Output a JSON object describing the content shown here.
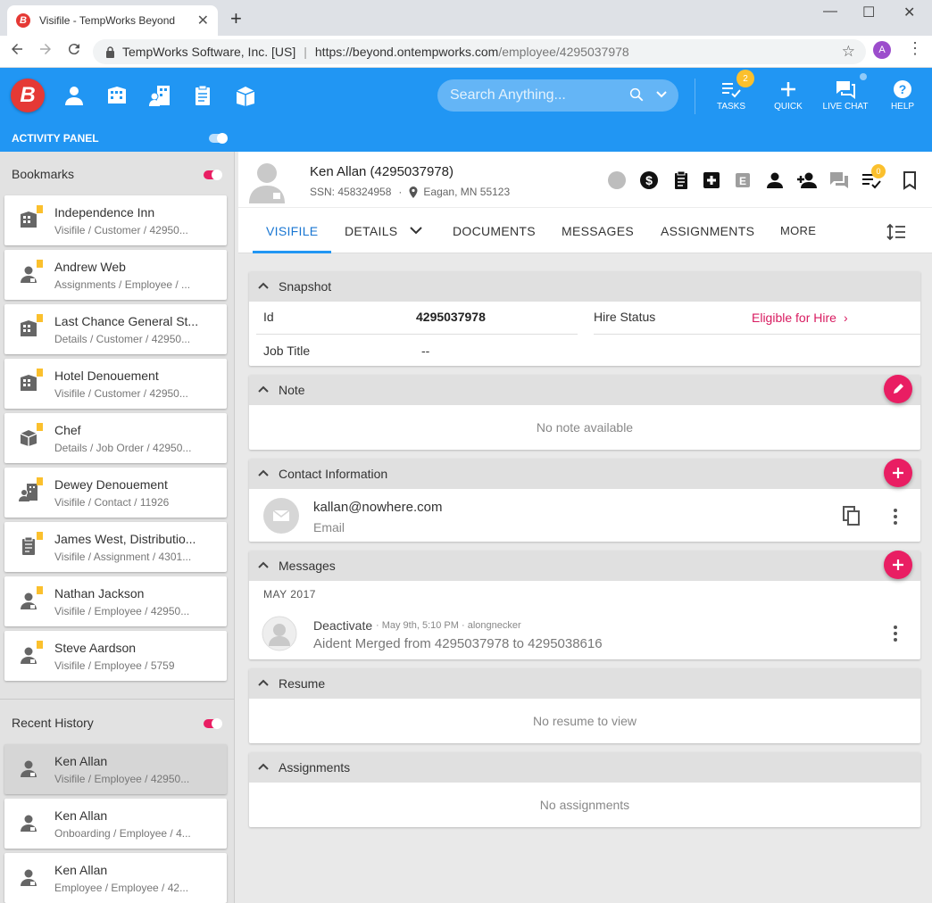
{
  "browser": {
    "tab_title": "Visifile - TempWorks Beyond",
    "tab_favicon": "B",
    "close_tab": "✕",
    "new_tab": "+",
    "window_min": "—",
    "window_max": "☐",
    "window_close": "✕",
    "org_label": "TempWorks Software, Inc. [US]",
    "url_host": "https://beyond.ontempworks.com",
    "url_path": "/employee/4295037978",
    "profile_initial": "A"
  },
  "header": {
    "logo": "B",
    "search_placeholder": "Search Anything...",
    "tasks_label": "TASKS",
    "tasks_badge": "2",
    "quick_label": "QUICK",
    "live_chat_label": "LIVE CHAT",
    "help_label": "HELP"
  },
  "activity_panel": {
    "label": "ACTIVITY PANEL"
  },
  "sidebar": {
    "bookmarks_title": "Bookmarks",
    "recent_title": "Recent History",
    "bookmarks": [
      {
        "title": "Independence Inn",
        "sub": "Visifile / Customer / 42950...",
        "icon": "building-icon"
      },
      {
        "title": "Andrew Web",
        "sub": "Assignments / Employee / ...",
        "icon": "person-icon"
      },
      {
        "title": "Last Chance General St...",
        "sub": "Details / Customer / 42950...",
        "icon": "building-icon"
      },
      {
        "title": "Hotel Denouement",
        "sub": "Visifile / Customer / 42950...",
        "icon": "building-icon"
      },
      {
        "title": "Chef",
        "sub": "Details / Job Order / 42950...",
        "icon": "job-order-icon"
      },
      {
        "title": "Dewey Denouement",
        "sub": "Visifile / Contact / 11926",
        "icon": "contact-icon"
      },
      {
        "title": "James West, Distributio...",
        "sub": "Visifile / Assignment / 4301...",
        "icon": "clipboard-icon"
      },
      {
        "title": "Nathan Jackson",
        "sub": "Visifile / Employee / 42950...",
        "icon": "person-icon"
      },
      {
        "title": "Steve Aardson",
        "sub": "Visifile / Employee / 5759",
        "icon": "person-icon"
      }
    ],
    "recent": [
      {
        "title": "Ken Allan",
        "sub": "Visifile / Employee / 42950..."
      },
      {
        "title": "Ken Allan",
        "sub": "Onboarding / Employee / 4..."
      },
      {
        "title": "Ken Allan",
        "sub": "Employee / Employee / 42..."
      }
    ]
  },
  "employee": {
    "name": "Ken Allan (4295037978)",
    "ssn": "SSN: 458324958",
    "separator": "·",
    "location": "Eagan, MN 55123",
    "tasks_badge": "0"
  },
  "tabs": {
    "visifile": "VISIFILE",
    "details": "DETAILS",
    "documents": "DOCUMENTS",
    "messages": "MESSAGES",
    "assignments": "ASSIGNMENTS",
    "more": "MORE"
  },
  "snapshot": {
    "title": "Snapshot",
    "id_label": "Id",
    "id_value": "4295037978",
    "hire_status_label": "Hire Status",
    "hire_status_value": "Eligible for Hire",
    "job_title_label": "Job Title",
    "job_title_value": "--"
  },
  "note": {
    "title": "Note",
    "empty": "No note available"
  },
  "contact": {
    "title": "Contact Information",
    "email": "kallan@nowhere.com",
    "email_label": "Email"
  },
  "messages": {
    "title": "Messages",
    "month": "MAY 2017",
    "items": [
      {
        "type": "Deactivate",
        "meta": "· May 9th, 5:10 PM · alongnecker",
        "body": "Aident Merged from 4295037978 to 4295038616"
      }
    ]
  },
  "resume": {
    "title": "Resume",
    "empty": "No resume to view"
  },
  "assignments": {
    "title": "Assignments",
    "empty": "No assignments"
  },
  "colors": {
    "primary": "#2196f3",
    "accent": "#e91e63",
    "badge": "#fbc02d",
    "hire_status": "#d81b60"
  }
}
